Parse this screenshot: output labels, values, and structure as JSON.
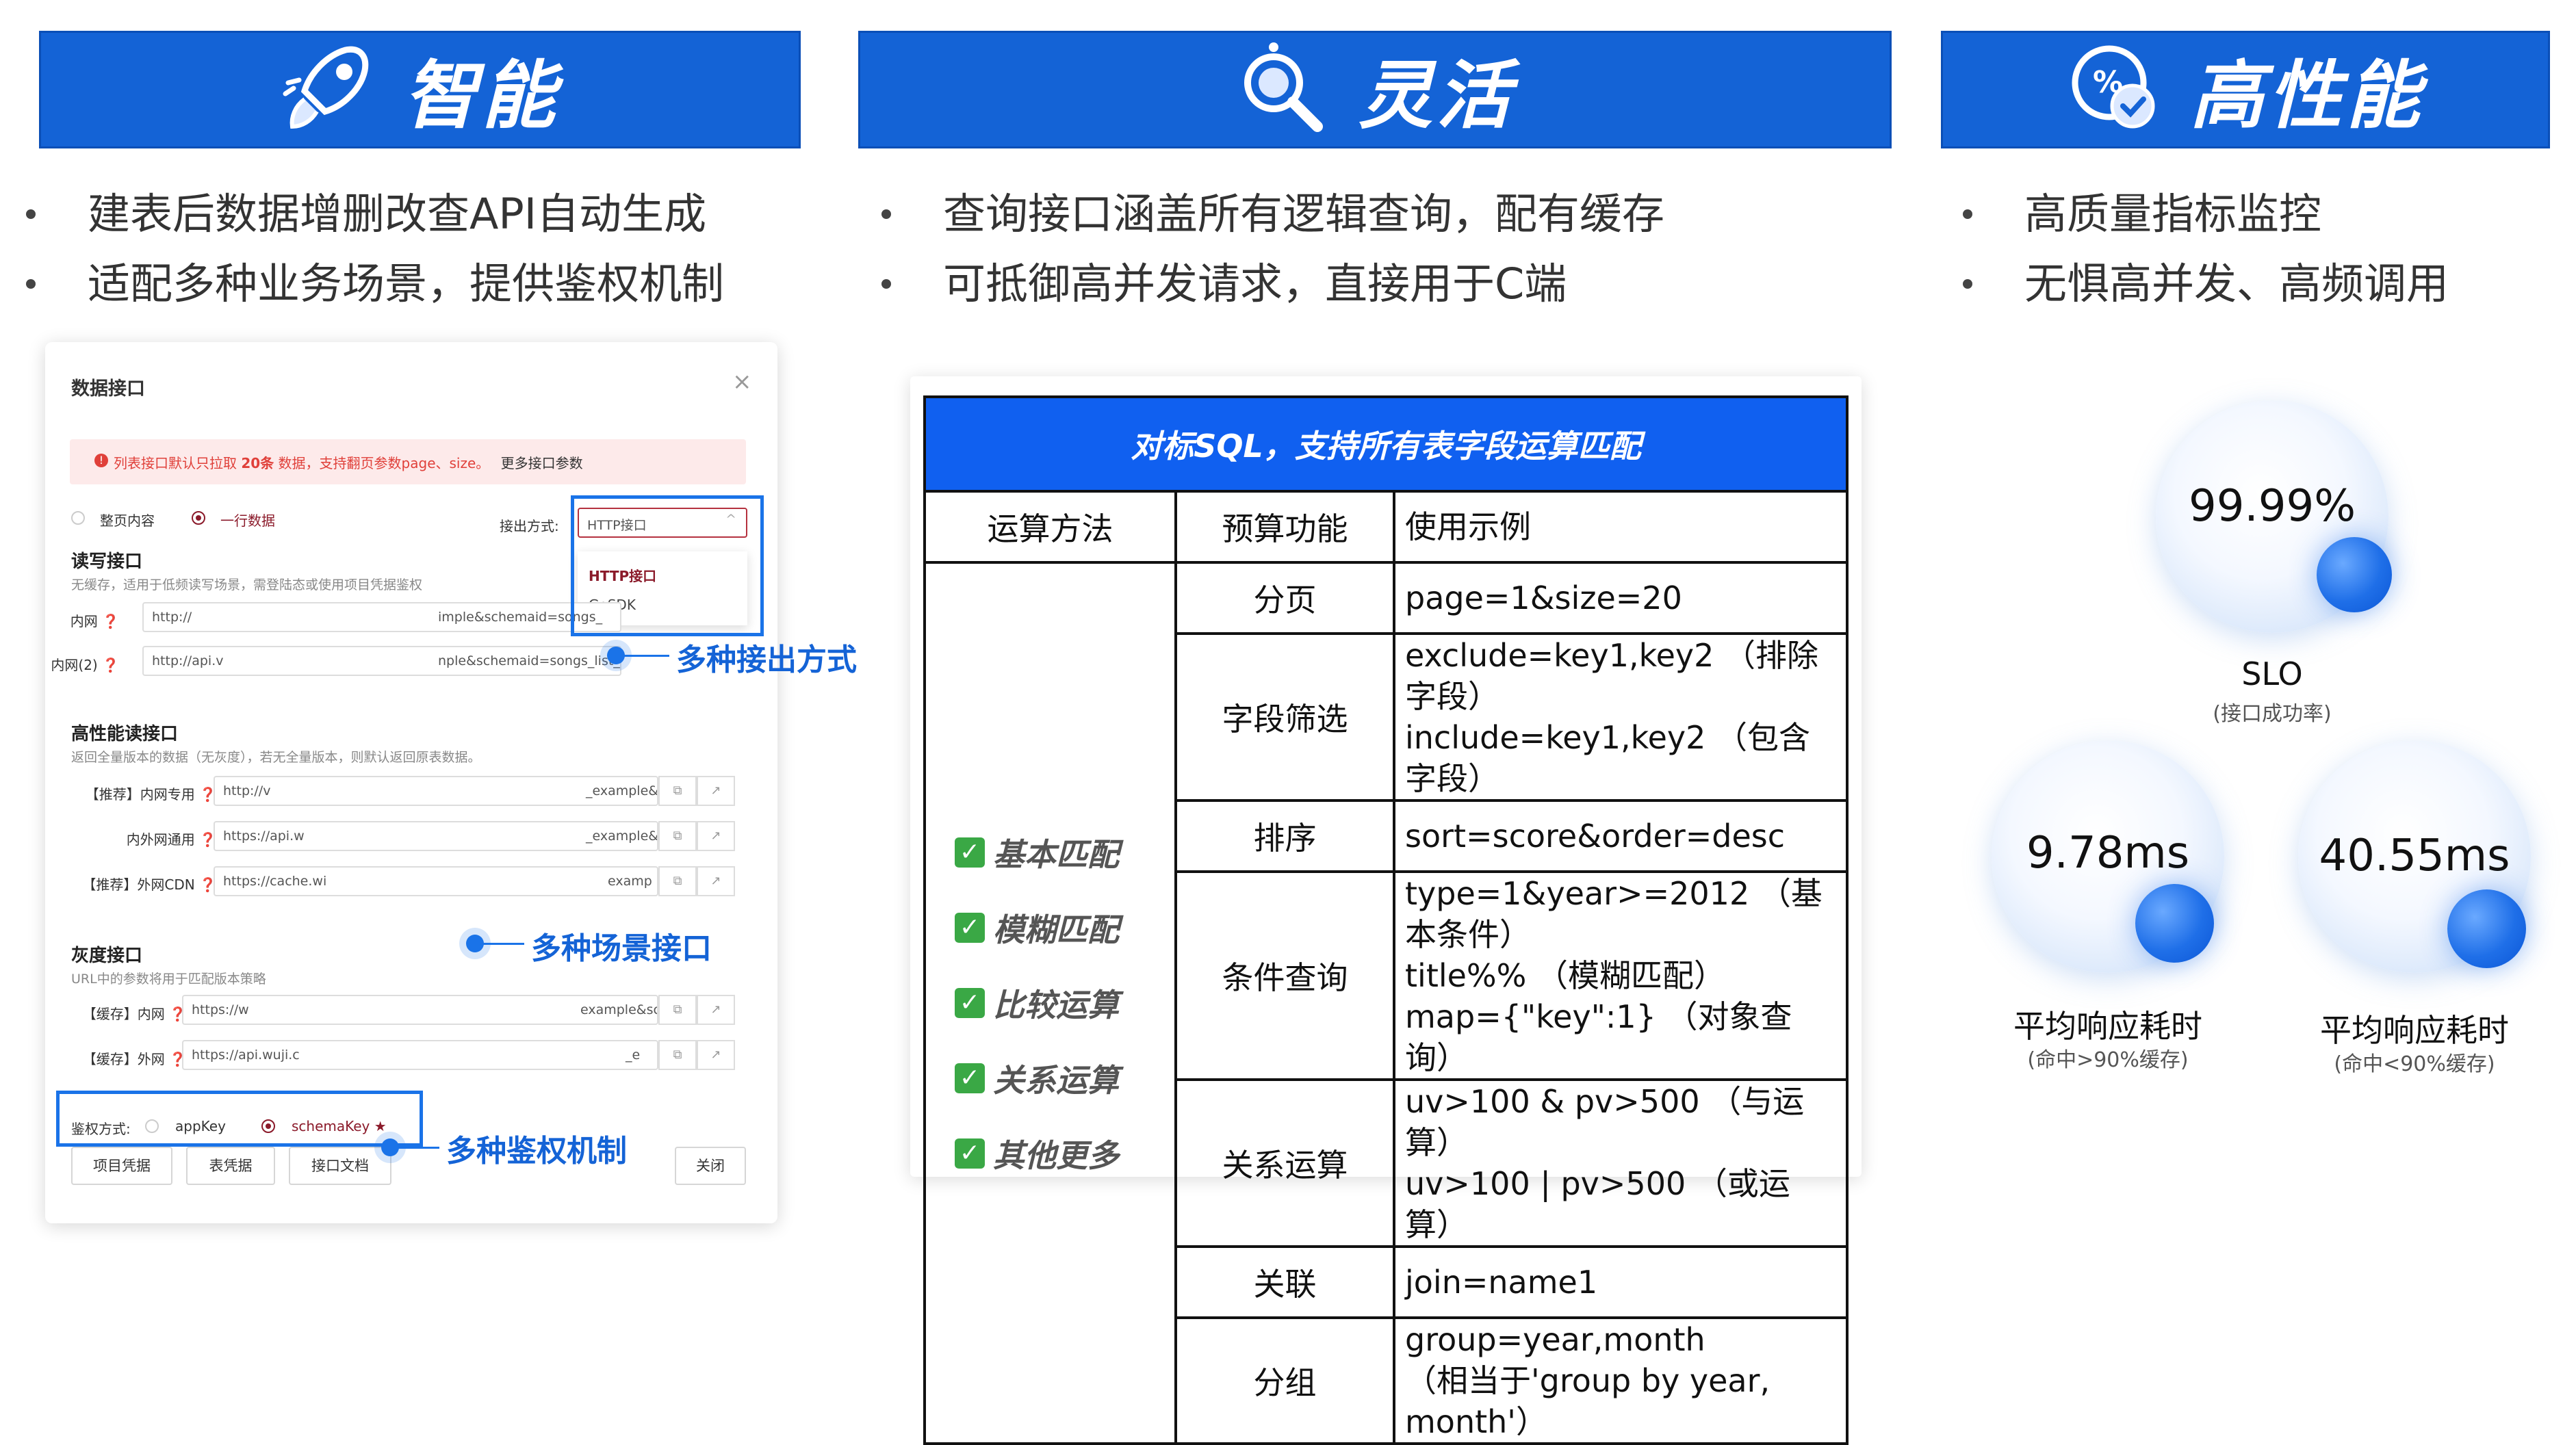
{
  "columns": [
    {
      "title": "智能",
      "icon": "rocket-icon",
      "bullets": [
        "建表后数据增删改查API自动生成",
        "适配多种业务场景，提供鉴权机制"
      ]
    },
    {
      "title": "灵活",
      "icon": "magnifier-icon",
      "bullets": [
        "查询接口涵盖所有逻辑查询，配有缓存",
        "可抵御高并发请求，直接用于C端"
      ]
    },
    {
      "title": "高性能",
      "icon": "percent-shield-icon",
      "bullets": [
        "高质量指标监控",
        "无惧高并发、高频调用"
      ]
    }
  ],
  "dialog": {
    "title": "数据接口",
    "close": "×",
    "alert_pre": "列表接口默认只拉取 ",
    "alert_bold": "20条",
    "alert_post": " 数据，支持翻页参数page、size。",
    "alert_link": "更多接口参数",
    "radio_page": "整页内容",
    "radio_row": "一行数据",
    "output_label": "接出方式:",
    "output_value": "HTTP接口",
    "output_options": [
      "HTTP接口",
      "GoSDK"
    ],
    "rw_title": "读写接口",
    "rw_hint": "无缓存，适用于低频读写场景，需登陆态或使用项目凭据鉴权",
    "rw_rows": [
      {
        "label": "内网 ❓",
        "value": "http://",
        "tail": "imple&schemaid=songs_"
      },
      {
        "label": "内网(2) ❓",
        "value": "http://api.v",
        "tail": "nple&schemaid=songs_list_vers"
      }
    ],
    "hp_title": "高性能读接口",
    "hp_hint": "返回全量版本的数据（无灰度），若无全量版本，则默认返回原表数据。",
    "hp_rows": [
      {
        "label": "【推荐】内网专用 ❓",
        "value": "http://v",
        "tail": "_example&s"
      },
      {
        "label": "内外网通用 ❓",
        "value": "https://api.w",
        "tail": "_example&s"
      },
      {
        "label": "【推荐】外网CDN ❓",
        "value": "https://cache.wi",
        "tail": "examp"
      }
    ],
    "gray_title": "灰度接口",
    "gray_hint": "URL中的参数将用于匹配版本策略",
    "gray_rows": [
      {
        "label": "【缓存】内网 ❓",
        "value": "https://w",
        "tail": "example&sc"
      },
      {
        "label": "【缓存】外网 ❓",
        "value": "https://api.wuji.c",
        "tail": "_e"
      }
    ],
    "auth_label": "鉴权方式:",
    "auth_app": "appKey",
    "auth_schema": "schemaKey ★",
    "buttons": [
      "项目凭据",
      "表凭据",
      "接口文档"
    ],
    "close_button": "关闭",
    "copy_glyph": "⧉",
    "open_glyph": "↗"
  },
  "callouts": {
    "output": "多种接出方式",
    "scene": "多种场景接口",
    "auth": "多种鉴权机制"
  },
  "table": {
    "title": "对标SQL，支持所有表字段运算匹配",
    "headers": [
      "运算方法",
      "预算功能",
      "使用示例"
    ],
    "features": [
      "基本匹配",
      "模糊匹配",
      "比较运算",
      "关系运算",
      "其他更多"
    ],
    "rows": [
      {
        "func": "分页",
        "examples": [
          "page=1&size=20"
        ]
      },
      {
        "func": "字段筛选",
        "examples": [
          "exclude=key1,key2 （排除字段）",
          "include=key1,key2 （包含字段）"
        ]
      },
      {
        "func": "排序",
        "examples": [
          "sort=score&order=desc"
        ]
      },
      {
        "func": "条件查询",
        "examples": [
          "type=1&year>=2012 （基本条件）",
          "title%% （模糊匹配）",
          "map={\"key\":1} （对象查询）"
        ]
      },
      {
        "func": "关系运算",
        "examples": [
          "uv>100 & pv>500 （与运算）",
          "uv>100 | pv>500 （或运算）"
        ]
      },
      {
        "func": "关联",
        "examples": [
          "join=name1"
        ]
      },
      {
        "func": "分组",
        "examples": [
          "group=year,month",
          "（相当于'group by year, month'）"
        ]
      }
    ]
  },
  "metrics": [
    {
      "value": "99.99%",
      "label": "SLO",
      "sub": "(接口成功率)"
    },
    {
      "value": "9.78ms",
      "label": "平均响应耗时",
      "sub": "(命中>90%缓存)"
    },
    {
      "value": "40.55ms",
      "label": "平均响应耗时",
      "sub": "(命中<90%缓存)"
    }
  ],
  "colors": {
    "accent": "#1463d6",
    "brand_dark_red": "#8b1a2a",
    "check_green": "#3aa845"
  }
}
